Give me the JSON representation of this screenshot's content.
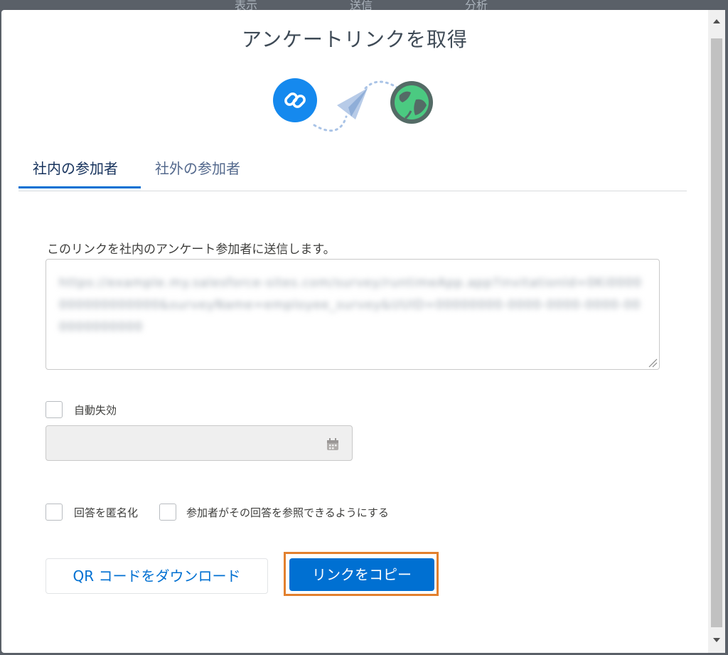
{
  "background_tabs": [
    "表示",
    "送信",
    "分析"
  ],
  "dialog": {
    "title": "アンケートリンクを取得",
    "hero": {
      "left_icon": "link-icon",
      "middle_icon": "paper-plane-icon",
      "right_icon": "globe-icon"
    },
    "tabs": [
      {
        "label": "社内の参加者",
        "active": true
      },
      {
        "label": "社外の参加者",
        "active": false
      }
    ],
    "description": "このリンクを社内のアンケート参加者に送信します。",
    "link_field": {
      "value": "https://example.my.salesforce-sites.com/survey/runtimeApp.app?invitationId=0Ki0000000000000000&surveyName=employee_survey&UUID=00000000-0000-0000-0000-000000000000"
    },
    "auto_expire": {
      "label": "自動失効",
      "checked": false
    },
    "date_input": {
      "value": "",
      "icon": "calendar-icon"
    },
    "anonymize": {
      "label": "回答を匿名化",
      "checked": false
    },
    "allow_view": {
      "label": "参加者がその回答を参照できるようにする",
      "checked": false
    },
    "buttons": {
      "qr_download": "QR コードをダウンロード",
      "copy_link": "リンクをコピー"
    }
  },
  "colors": {
    "brand_blue": "#0070d2",
    "highlight_orange": "#e2802e",
    "globe_green": "#4bca81"
  }
}
